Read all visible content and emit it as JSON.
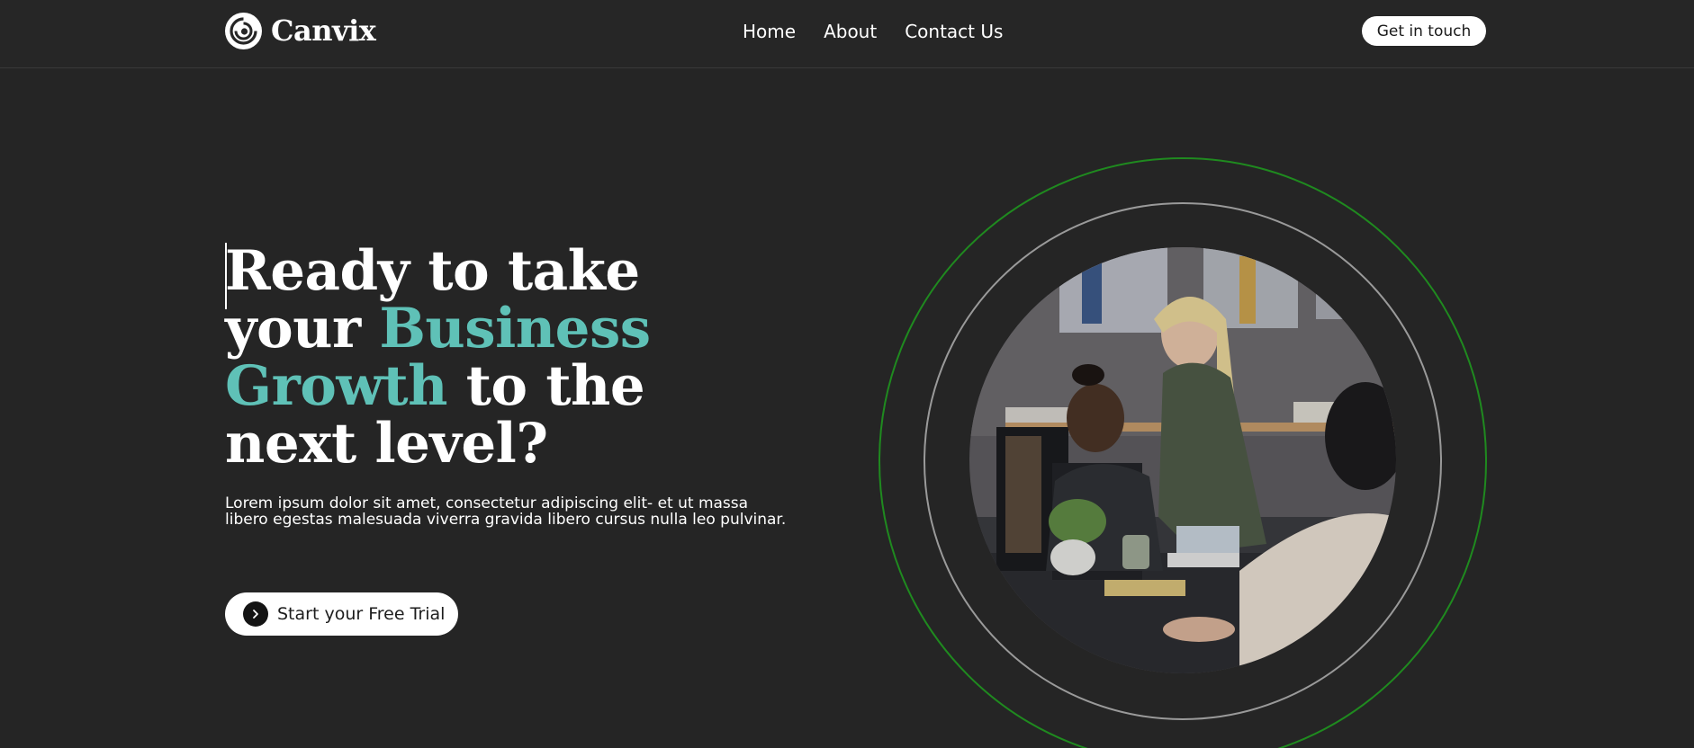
{
  "brand": {
    "name": "Canvix",
    "logo_icon": "spiral-logo-icon"
  },
  "nav": {
    "items": [
      "Home",
      "About",
      "Contact Us"
    ]
  },
  "header": {
    "cta_label": "Get in touch"
  },
  "hero": {
    "title_line1": "Ready to take",
    "title_word_your": "your",
    "title_accent1": "Business",
    "title_accent2": "Growth",
    "title_to_the": "to the",
    "title_line4": "next level?",
    "description": "Lorem ipsum dolor sit amet, consectetur adipiscing elit- et ut massa libero egestas malesuada viverra gravida libero cursus nulla leo pulvinar.",
    "cta_label": "Start your Free Trial",
    "cta_icon": "chevron-right-icon"
  },
  "colors": {
    "background": "#252525",
    "accent": "#5fc1b7",
    "outer_ring": "#1f8a1f",
    "inner_ring": "#9a9a9a"
  }
}
